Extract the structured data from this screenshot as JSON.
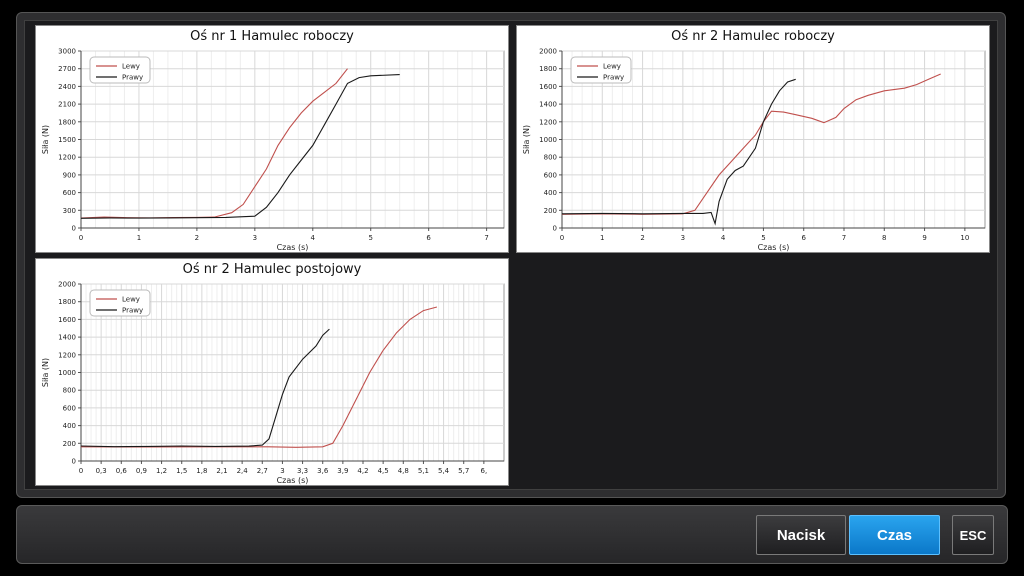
{
  "toolbar": {
    "nacisk_label": "Nacisk",
    "czas_label": "Czas",
    "esc_label": "ESC"
  },
  "colors": {
    "lewy": "#c0504d",
    "prawy": "#1a1a1a",
    "active_button": "#1a8fe0"
  },
  "chart_data": [
    {
      "type": "line",
      "title": "Oś nr 1 Hamulec roboczy",
      "xlabel": "Czas (s)",
      "ylabel": "Siła (N)",
      "xlim": [
        0,
        7.3
      ],
      "ylim": [
        0,
        3000
      ],
      "xticks": [
        0,
        1,
        2,
        3,
        4,
        5,
        6,
        7
      ],
      "xtick_labels": [
        "0",
        "1",
        "2",
        "3",
        "4",
        "5",
        "6",
        "7"
      ],
      "yticks": [
        0,
        300,
        600,
        900,
        1200,
        1500,
        1800,
        2100,
        2400,
        2700,
        3000
      ],
      "ytick_labels": [
        "0",
        "300",
        "600",
        "900",
        "1200",
        "1500",
        "1800",
        "2100",
        "2400",
        "2700",
        "3000"
      ],
      "grid": true,
      "legend": "top-left",
      "series": [
        {
          "name": "Lewy",
          "color": "#c0504d",
          "points": [
            [
              0,
              170
            ],
            [
              0.4,
              185
            ],
            [
              0.8,
              175
            ],
            [
              1.2,
              172
            ],
            [
              1.6,
              178
            ],
            [
              2.0,
              180
            ],
            [
              2.3,
              185
            ],
            [
              2.6,
              260
            ],
            [
              2.8,
              400
            ],
            [
              3.0,
              700
            ],
            [
              3.2,
              1000
            ],
            [
              3.4,
              1400
            ],
            [
              3.6,
              1700
            ],
            [
              3.8,
              1950
            ],
            [
              4.0,
              2150
            ],
            [
              4.2,
              2300
            ],
            [
              4.4,
              2450
            ],
            [
              4.6,
              2700
            ]
          ]
        },
        {
          "name": "Prawy",
          "color": "#1a1a1a",
          "points": [
            [
              0,
              165
            ],
            [
              0.5,
              172
            ],
            [
              1.0,
              168
            ],
            [
              1.5,
              172
            ],
            [
              2.0,
              175
            ],
            [
              2.5,
              180
            ],
            [
              3.0,
              200
            ],
            [
              3.2,
              350
            ],
            [
              3.4,
              600
            ],
            [
              3.6,
              900
            ],
            [
              3.8,
              1150
            ],
            [
              4.0,
              1400
            ],
            [
              4.2,
              1750
            ],
            [
              4.4,
              2100
            ],
            [
              4.6,
              2450
            ],
            [
              4.8,
              2550
            ],
            [
              5.0,
              2580
            ],
            [
              5.5,
              2600
            ]
          ]
        }
      ]
    },
    {
      "type": "line",
      "title": "Oś nr 2 Hamulec roboczy",
      "xlabel": "Czas (s)",
      "ylabel": "Siła (N)",
      "xlim": [
        0,
        10.5
      ],
      "ylim": [
        0,
        2000
      ],
      "xticks": [
        0,
        1,
        2,
        3,
        4,
        5,
        6,
        7,
        8,
        9,
        10
      ],
      "xtick_labels": [
        "0",
        "1",
        "2",
        "3",
        "4",
        "5",
        "6",
        "7",
        "8",
        "9",
        "10"
      ],
      "yticks": [
        0,
        200,
        400,
        600,
        800,
        1000,
        1200,
        1400,
        1600,
        1800,
        2000
      ],
      "ytick_labels": [
        "0",
        "200",
        "400",
        "600",
        "800",
        "1000",
        "1200",
        "1400",
        "1600",
        "1800",
        "2000"
      ],
      "grid": true,
      "legend": "top-left",
      "series": [
        {
          "name": "Lewy",
          "color": "#c0504d",
          "points": [
            [
              0,
              155
            ],
            [
              1,
              160
            ],
            [
              2,
              155
            ],
            [
              3,
              160
            ],
            [
              3.3,
              200
            ],
            [
              3.6,
              400
            ],
            [
              3.9,
              600
            ],
            [
              4.2,
              750
            ],
            [
              4.5,
              900
            ],
            [
              4.8,
              1050
            ],
            [
              5.0,
              1200
            ],
            [
              5.2,
              1320
            ],
            [
              5.5,
              1310
            ],
            [
              5.8,
              1280
            ],
            [
              6.2,
              1240
            ],
            [
              6.5,
              1190
            ],
            [
              6.8,
              1250
            ],
            [
              7.0,
              1350
            ],
            [
              7.3,
              1450
            ],
            [
              7.6,
              1500
            ],
            [
              8.0,
              1550
            ],
            [
              8.5,
              1580
            ],
            [
              8.8,
              1620
            ],
            [
              9.1,
              1680
            ],
            [
              9.4,
              1740
            ]
          ]
        },
        {
          "name": "Prawy",
          "color": "#1a1a1a",
          "points": [
            [
              0,
              160
            ],
            [
              1,
              165
            ],
            [
              2,
              160
            ],
            [
              3,
              165
            ],
            [
              3.5,
              165
            ],
            [
              3.7,
              175
            ],
            [
              3.8,
              50
            ],
            [
              3.9,
              300
            ],
            [
              4.1,
              550
            ],
            [
              4.3,
              650
            ],
            [
              4.5,
              700
            ],
            [
              4.8,
              900
            ],
            [
              5.0,
              1200
            ],
            [
              5.2,
              1400
            ],
            [
              5.4,
              1550
            ],
            [
              5.6,
              1650
            ],
            [
              5.8,
              1680
            ]
          ]
        }
      ]
    },
    {
      "type": "line",
      "title": "Oś nr 2 Hamulec postojowy",
      "xlabel": "Czas (s)",
      "ylabel": "Siła (N)",
      "xlim": [
        0,
        6.3
      ],
      "ylim": [
        0,
        2000
      ],
      "xticks": [
        0,
        0.3,
        0.6,
        0.9,
        1.2,
        1.5,
        1.8,
        2.1,
        2.4,
        2.7,
        3.0,
        3.3,
        3.6,
        3.9,
        4.2,
        4.5,
        4.8,
        5.1,
        5.4,
        5.7,
        6.0
      ],
      "xtick_labels": [
        "0",
        "0,3",
        "0,6",
        "0,9",
        "1,2",
        "1,5",
        "1,8",
        "2,1",
        "2,4",
        "2,7",
        "3",
        "3,3",
        "3,6",
        "3,9",
        "4,2",
        "4,5",
        "4,8",
        "5,1",
        "5,4",
        "5,7",
        "6,"
      ],
      "yticks": [
        0,
        200,
        400,
        600,
        800,
        1000,
        1200,
        1400,
        1600,
        1800,
        2000
      ],
      "ytick_labels": [
        "0",
        "200",
        "400",
        "600",
        "800",
        "1000",
        "1200",
        "1400",
        "1600",
        "1800",
        "2000"
      ],
      "grid": true,
      "legend": "top-left",
      "series": [
        {
          "name": "Lewy",
          "color": "#c0504d",
          "points": [
            [
              0,
              160
            ],
            [
              1.0,
              158
            ],
            [
              2.0,
              160
            ],
            [
              2.8,
              160
            ],
            [
              3.2,
              155
            ],
            [
              3.6,
              160
            ],
            [
              3.75,
              200
            ],
            [
              3.9,
              400
            ],
            [
              4.1,
              700
            ],
            [
              4.3,
              1000
            ],
            [
              4.5,
              1250
            ],
            [
              4.7,
              1450
            ],
            [
              4.9,
              1600
            ],
            [
              5.1,
              1700
            ],
            [
              5.3,
              1740
            ]
          ]
        },
        {
          "name": "Prawy",
          "color": "#1a1a1a",
          "points": [
            [
              0,
              170
            ],
            [
              0.5,
              162
            ],
            [
              1.0,
              165
            ],
            [
              1.5,
              170
            ],
            [
              2.0,
              165
            ],
            [
              2.5,
              168
            ],
            [
              2.7,
              180
            ],
            [
              2.8,
              250
            ],
            [
              2.9,
              500
            ],
            [
              3.0,
              750
            ],
            [
              3.1,
              950
            ],
            [
              3.3,
              1150
            ],
            [
              3.5,
              1300
            ],
            [
              3.6,
              1420
            ],
            [
              3.7,
              1490
            ]
          ]
        }
      ]
    }
  ]
}
